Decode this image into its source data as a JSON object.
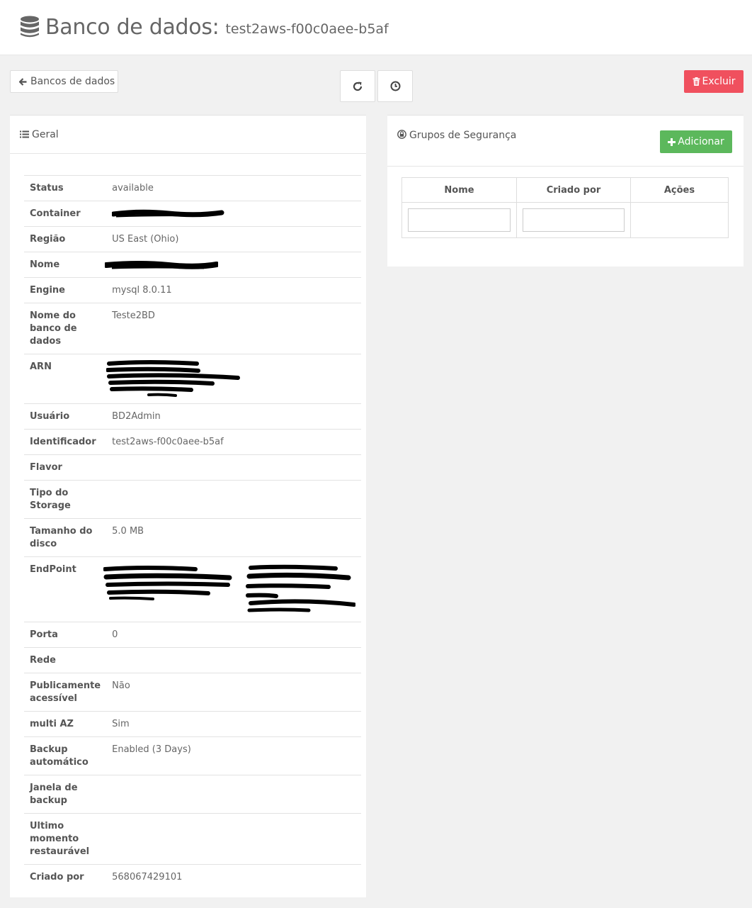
{
  "header": {
    "title": "Banco de dados:",
    "subtitle": "test2aws-f00c0aee-b5af",
    "icon": "database-icon"
  },
  "toolbar": {
    "back_label": "Bancos de dados",
    "back_icon": "arrow-left-icon",
    "refresh_icon": "refresh-icon",
    "history_icon": "clock-icon",
    "delete_label": "Excluir",
    "delete_icon": "trash-icon",
    "delete_color": "#f0505e"
  },
  "general": {
    "title": "Geral",
    "icon": "list-icon",
    "rows": [
      {
        "key": "Status",
        "value": "available"
      },
      {
        "key": "Container",
        "value": ""
      },
      {
        "key": "Região",
        "value": "US East (Ohio)"
      },
      {
        "key": "Nome",
        "value": ""
      },
      {
        "key": "Engine",
        "value": "mysql 8.0.11"
      },
      {
        "key": "Nome do banco de dados",
        "value": "Teste2BD"
      },
      {
        "key": "ARN",
        "value": ""
      },
      {
        "key": "Usuário",
        "value": "BD2Admin"
      },
      {
        "key": "Identificador",
        "value": "test2aws-f00c0aee-b5af"
      },
      {
        "key": "Flavor",
        "value": ""
      },
      {
        "key": "Tipo do Storage",
        "value": ""
      },
      {
        "key": "Tamanho do disco",
        "value": "5.0 MB"
      },
      {
        "key": "EndPoint",
        "value": ""
      },
      {
        "key": "Porta",
        "value": "0"
      },
      {
        "key": "Rede",
        "value": ""
      },
      {
        "key": "Publicamente acessível",
        "value": "Não"
      },
      {
        "key": "multi AZ",
        "value": "Sim"
      },
      {
        "key": "Backup automático",
        "value": "Enabled (3 Days)"
      },
      {
        "key": "Janela de backup",
        "value": ""
      },
      {
        "key": "Ultimo momento restaurável",
        "value": ""
      },
      {
        "key": "Criado por",
        "value": "568067429101"
      }
    ]
  },
  "security_groups": {
    "title": "Grupos de Segurança",
    "icon": "lock-icon",
    "add_label": "Adicionar",
    "add_icon": "plus-icon",
    "add_color": "#5cb85c",
    "columns": [
      "Nome",
      "Criado por",
      "Ações"
    ],
    "filter_nome": "",
    "filter_criado": ""
  }
}
